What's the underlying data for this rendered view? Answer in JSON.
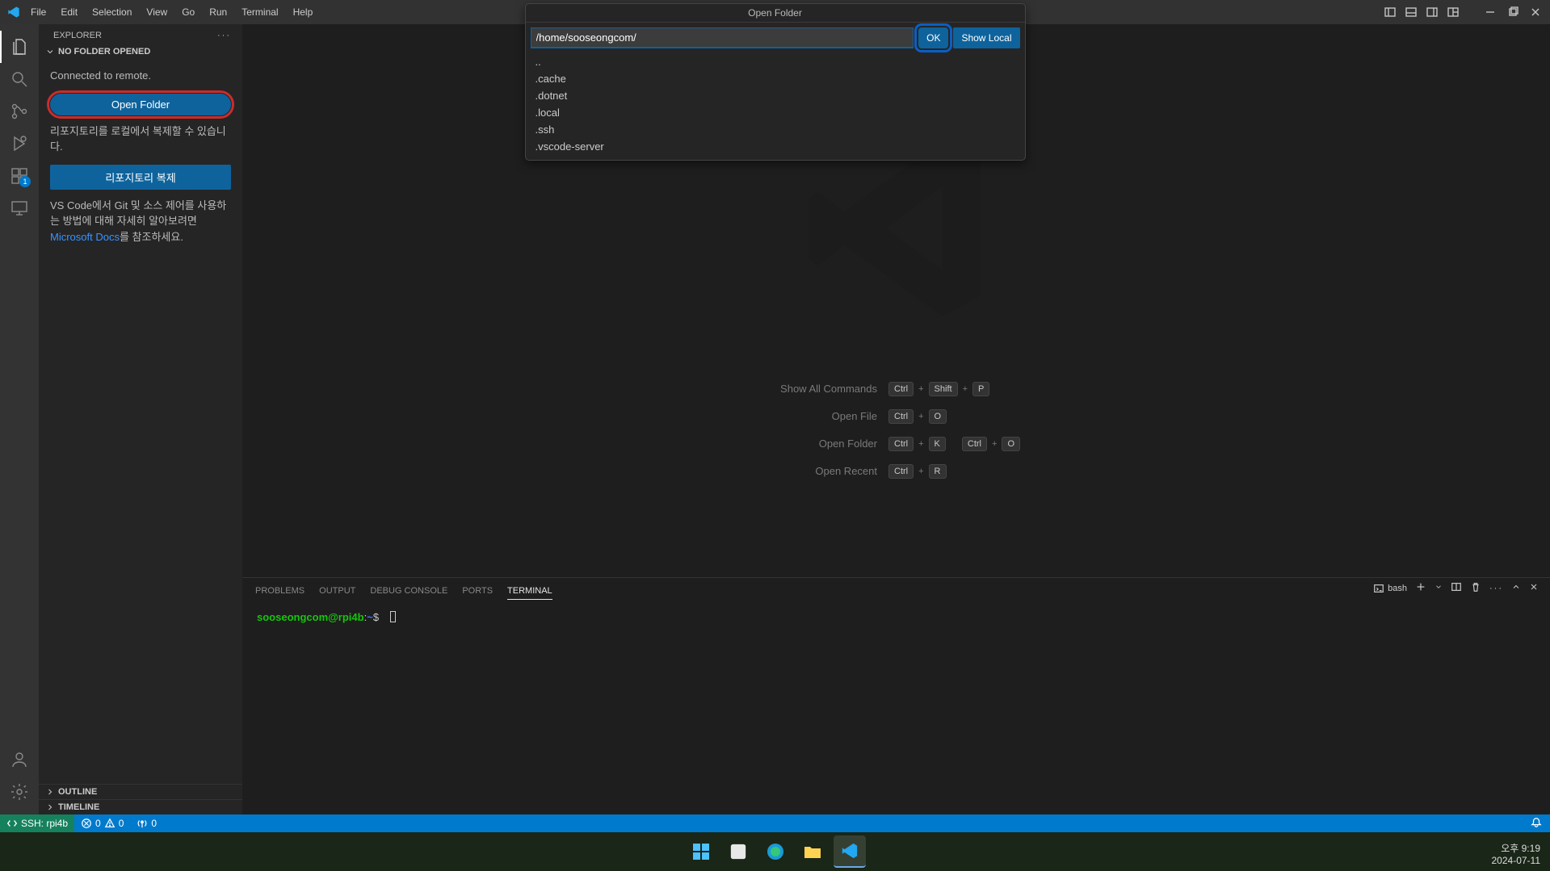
{
  "menu": [
    "File",
    "Edit",
    "Selection",
    "View",
    "Go",
    "Run",
    "Terminal",
    "Help"
  ],
  "dialog": {
    "title": "Open Folder",
    "path": "/home/sooseongcom/",
    "ok": "OK",
    "show_local": "Show Local",
    "items": [
      "..",
      ".cache",
      ".dotnet",
      ".local",
      ".ssh",
      ".vscode-server"
    ]
  },
  "sidebar": {
    "title": "EXPLORER",
    "section": "NO FOLDER OPENED",
    "connected": "Connected to remote.",
    "open_folder_btn": "Open Folder",
    "clone_hint": "리포지토리를 로컬에서 복제할 수 있습니다.",
    "clone_btn": "리포지토리 복제",
    "docs_text_pre": "VS Code에서 Git 및 소스 제어를 사용하는 방법에 대해 자세히 알아보려면 ",
    "docs_link": "Microsoft Docs",
    "docs_text_post": "를 참조하세요.",
    "outline": "OUTLINE",
    "timeline": "TIMELINE"
  },
  "shortcuts": [
    {
      "label": "Show All Commands",
      "keys": [
        "Ctrl",
        "Shift",
        "P"
      ]
    },
    {
      "label": "Open File",
      "keys": [
        "Ctrl",
        "O"
      ]
    },
    {
      "label": "Open Folder",
      "keyGroups": [
        [
          "Ctrl",
          "K"
        ],
        [
          "Ctrl",
          "O"
        ]
      ]
    },
    {
      "label": "Open Recent",
      "keys": [
        "Ctrl",
        "R"
      ]
    }
  ],
  "panel": {
    "tabs": [
      "PROBLEMS",
      "OUTPUT",
      "DEBUG CONSOLE",
      "PORTS",
      "TERMINAL"
    ],
    "active_tab": 4,
    "shell": "bash",
    "prompt_user": "sooseongcom@rpi4b",
    "prompt_path": "~",
    "prompt_symbol": "$"
  },
  "status": {
    "remote": "SSH: rpi4b",
    "errors": "0",
    "warnings": "0",
    "ports": "0"
  },
  "activity_badge": "1",
  "taskbar": {
    "time": "오후 9:19",
    "date": "2024-07-11"
  }
}
